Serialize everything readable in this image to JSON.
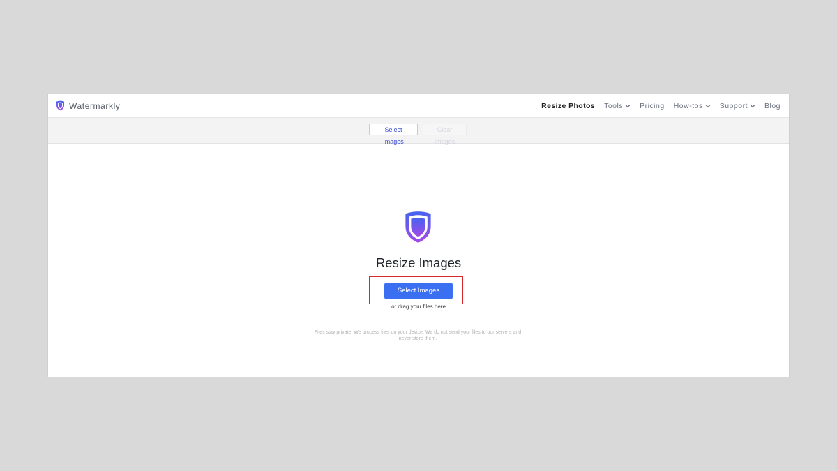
{
  "brand": {
    "name": "Watermarkly",
    "logo_icon": "shield-icon",
    "accent_colors": [
      "#3f6cf0",
      "#a545e8"
    ]
  },
  "nav": {
    "items": [
      {
        "label": "Resize Photos",
        "active": true,
        "dropdown": false
      },
      {
        "label": "Tools",
        "active": false,
        "dropdown": true
      },
      {
        "label": "Pricing",
        "active": false,
        "dropdown": false
      },
      {
        "label": "How-tos",
        "active": false,
        "dropdown": true
      },
      {
        "label": "Support",
        "active": false,
        "dropdown": true
      },
      {
        "label": "Blog",
        "active": false,
        "dropdown": false
      }
    ]
  },
  "toolbar": {
    "select_label": "Select Images",
    "clear_label": "Clear Images"
  },
  "main": {
    "title": "Resize Images",
    "button_label": "Select Images",
    "drag_hint": "or drag your files here",
    "privacy_note": "Files stay private. We process files on your device. We do not send your files to our servers and never store them.",
    "button_color": "#3b6ff2",
    "highlight_color": "#d7282b"
  }
}
